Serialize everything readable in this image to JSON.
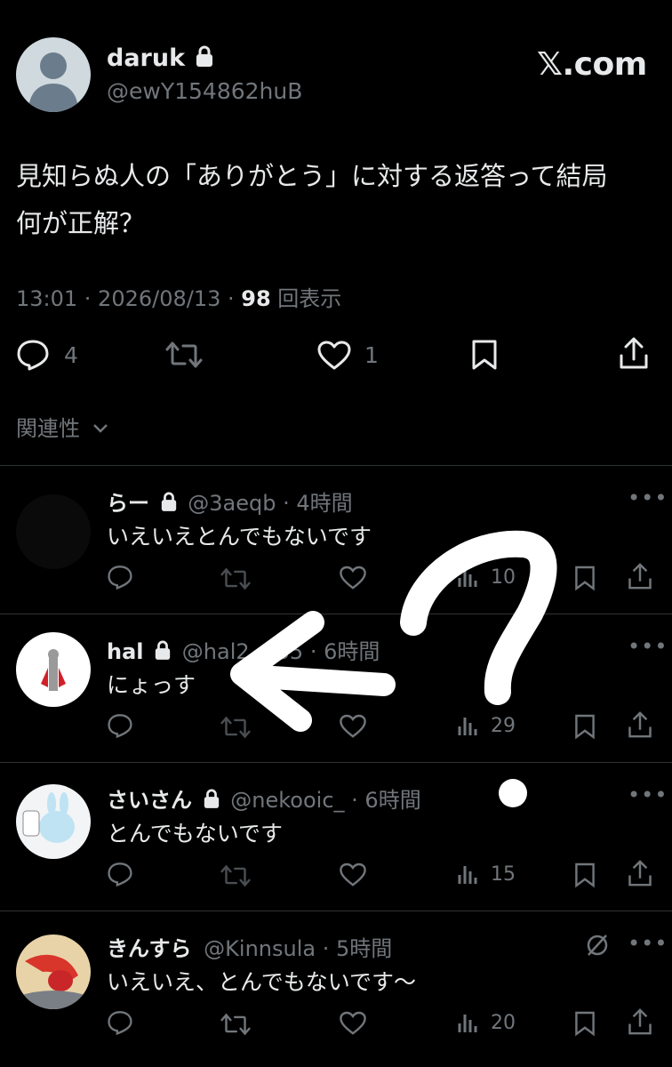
{
  "header": {
    "display_name": "daruk",
    "handle": "@ewY154862huB",
    "brand": "𝕏.com"
  },
  "tweet": {
    "text_line1": "見知らぬ人の「ありがとう」に対する返答って結局",
    "text_line2": "何が正解？",
    "time": "13:01 · 2026/08/13 · ",
    "views": "98",
    "views_label": " 回表示",
    "reply_count": "4",
    "like_count": "1"
  },
  "sort_label": "関連性",
  "replies": [
    {
      "name": "らー",
      "handle": "@3aeqb",
      "time": "4時間",
      "text": "いえいえとんでもないです",
      "views": "10",
      "locked": true
    },
    {
      "name": "hal",
      "handle": "@hal2",
      "handle_tail": "35",
      "time": "6時間",
      "text": "にょっす",
      "views": "29",
      "locked": true
    },
    {
      "name": "さいさん",
      "handle": "@nekooic_",
      "time": "6時間",
      "text": "とんでもないです",
      "views": "15",
      "locked": true
    },
    {
      "name": "きんすら",
      "handle": "@Kinnsula",
      "time": "5時間",
      "text": "いえいえ、とんでもないです〜",
      "views": "20",
      "locked": false
    }
  ],
  "separator": " · ",
  "more_label": "•••",
  "colors": {
    "background": "#000000",
    "text": "#e7e9ea",
    "muted": "#71767b",
    "divider": "#2f3336",
    "annotation": "#ffffff"
  }
}
